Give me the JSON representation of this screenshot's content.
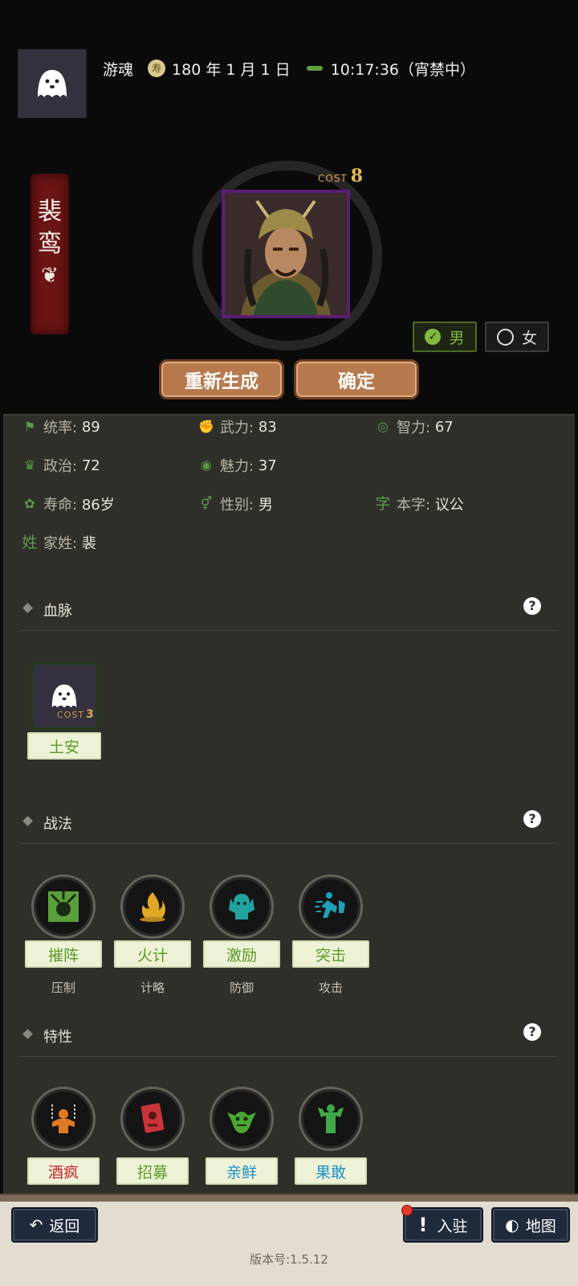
{
  "header": {
    "player_name": "游魂",
    "date": "180 年 1 月 1 日",
    "time": "10:17:36（宵禁中）"
  },
  "character": {
    "name_chars": [
      "裴",
      "鸾"
    ],
    "cost_label": "COST",
    "cost_value": "8",
    "gender_male": "男",
    "gender_female": "女",
    "selected_gender": "男"
  },
  "buttons": {
    "regenerate": "重新生成",
    "confirm": "确定"
  },
  "stats": {
    "tongshuai_label": "统率:",
    "tongshuai": "89",
    "wuli_label": "武力:",
    "wuli": "83",
    "zhili_label": "智力:",
    "zhili": "67",
    "zhengzhi_label": "政治:",
    "zhengzhi": "72",
    "meili_label": "魅力:",
    "meili": "37",
    "shouming_label": "寿命:",
    "shouming": "86岁",
    "xingbie_label": "性别:",
    "xingbie": "男",
    "benzi_icon": "字",
    "benzi_label": "本字:",
    "benzi": "议公",
    "jiaxing_icon": "姓",
    "jiaxing_label": "家姓:",
    "jiaxing": "裴"
  },
  "sections": {
    "bloodline": "血脉",
    "tactics": "战法",
    "traits": "特性"
  },
  "bloodline": {
    "cost_label": "COST",
    "cost_value": "3",
    "name": "土安"
  },
  "tactics": [
    {
      "name": "摧阵",
      "type": "压制"
    },
    {
      "name": "火计",
      "type": "计略"
    },
    {
      "name": "激励",
      "type": "防御"
    },
    {
      "name": "突击",
      "type": "攻击"
    }
  ],
  "traits": [
    {
      "name": "酒疯"
    },
    {
      "name": "招募"
    },
    {
      "name": "亲鲜"
    },
    {
      "name": "果敢"
    }
  ],
  "footer": {
    "back": "返回",
    "stay": "入驻",
    "map": "地图",
    "version": "版本号:1.5.12"
  },
  "colors": {
    "panel_bg": "#2f2f2a",
    "accent_green": "#7fba3c",
    "banner_red": "#6b1414",
    "button_brown": "#b77a4e",
    "nav_blue": "#1f2a3a"
  },
  "icons": [
    "ghost-avatar-icon",
    "seal-icon",
    "ant-icon",
    "feather-icon",
    "flag-icon",
    "arm-icon",
    "brain-icon",
    "crown-icon",
    "eye-icon",
    "longevity-icon",
    "gender-icon",
    "check-icon",
    "help-icon",
    "back-arrow-icon",
    "exclamation-icon",
    "map-icon"
  ]
}
